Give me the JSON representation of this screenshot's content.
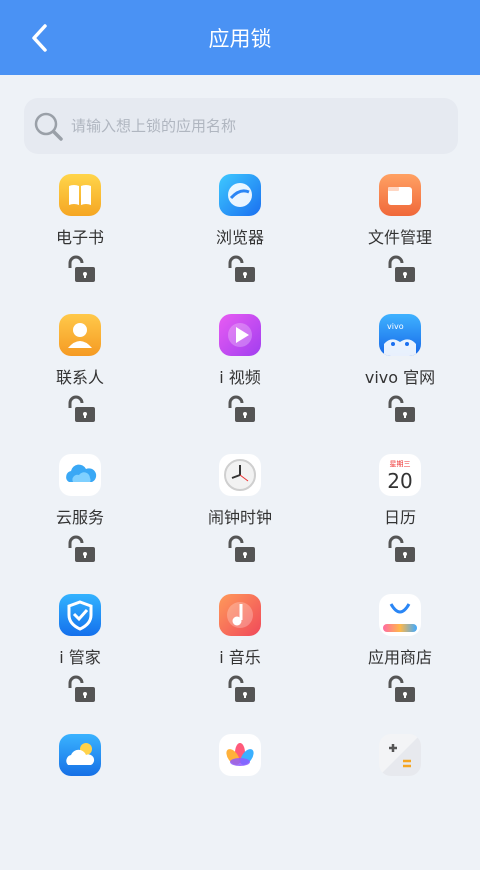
{
  "header": {
    "title": "应用锁",
    "back_icon": "chevron-left-icon"
  },
  "search": {
    "placeholder": "请输入想上锁的应用名称",
    "icon": "search-icon"
  },
  "apps": [
    {
      "label": "电子书",
      "icon": "book-icon",
      "locked": false
    },
    {
      "label": "浏览器",
      "icon": "browser-icon",
      "locked": false
    },
    {
      "label": "文件管理",
      "icon": "folder-icon",
      "locked": false
    },
    {
      "label": "联系人",
      "icon": "contacts-icon",
      "locked": false
    },
    {
      "label": "i 视频",
      "icon": "video-play-icon",
      "locked": false
    },
    {
      "label": "vivo 官网",
      "icon": "vivo-shop-icon",
      "locked": false
    },
    {
      "label": "云服务",
      "icon": "cloud-icon",
      "locked": false
    },
    {
      "label": "闹钟时钟",
      "icon": "clock-icon",
      "locked": false
    },
    {
      "label": "日历",
      "icon": "calendar-icon",
      "locked": false
    },
    {
      "label": "i 管家",
      "icon": "shield-icon",
      "locked": false
    },
    {
      "label": "i 音乐",
      "icon": "music-icon",
      "locked": false
    },
    {
      "label": "应用商店",
      "icon": "app-store-icon",
      "locked": false
    },
    {
      "label": "",
      "icon": "weather-icon",
      "locked": false
    },
    {
      "label": "",
      "icon": "gallery-flower-icon",
      "locked": false
    },
    {
      "label": "",
      "icon": "calculator-icon",
      "locked": false
    }
  ],
  "icon_text": {
    "vivo": "vivo",
    "calendar_weekday": "星期三",
    "calendar_day": "20"
  },
  "colors": {
    "header": "#4a92f4",
    "background": "#eef2f7",
    "lock_icon": "#555555"
  }
}
